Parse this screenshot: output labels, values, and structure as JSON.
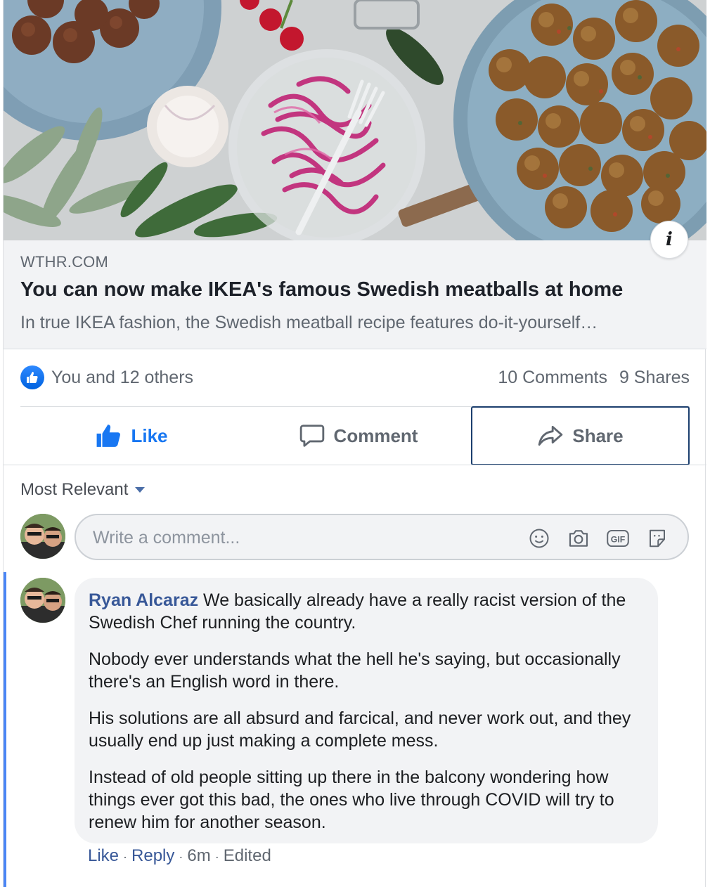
{
  "link_preview": {
    "domain": "WTHR.COM",
    "title": "You can now make IKEA's famous Swedish meatballs at home",
    "description": "In true IKEA fashion, the Swedish meatball recipe features do-it-yourself…",
    "info_icon": "info-icon"
  },
  "reactions": {
    "summary": "You and 12 others",
    "comments": "10 Comments",
    "shares": "9 Shares"
  },
  "actions": {
    "like": "Like",
    "comment": "Comment",
    "share": "Share"
  },
  "comments_section": {
    "sort_label": "Most Relevant",
    "composer_placeholder": "Write a comment...",
    "composer_icons": [
      "emoji-icon",
      "camera-icon",
      "gif-icon",
      "sticker-icon"
    ]
  },
  "comment": {
    "author": "Ryan Alcaraz",
    "paragraph1": "We basically already have a really racist version of the Swedish Chef running the country.",
    "paragraph2": "Nobody ever understands what the hell he's saying, but occasionally there's an English word in there.",
    "paragraph3": "His solutions are all absurd and farcical, and never work out, and they usually end up just making a complete mess.",
    "paragraph4": "Instead of old people sitting up there in the balcony wondering how things ever got this bad, the ones who live through COVID will try to renew him for another season.",
    "like": "Like",
    "reply": "Reply",
    "time": "6m",
    "edited": "Edited"
  },
  "colors": {
    "link_blue": "#385898",
    "like_blue": "#1877f2",
    "thread_line": "#4a85f5"
  }
}
